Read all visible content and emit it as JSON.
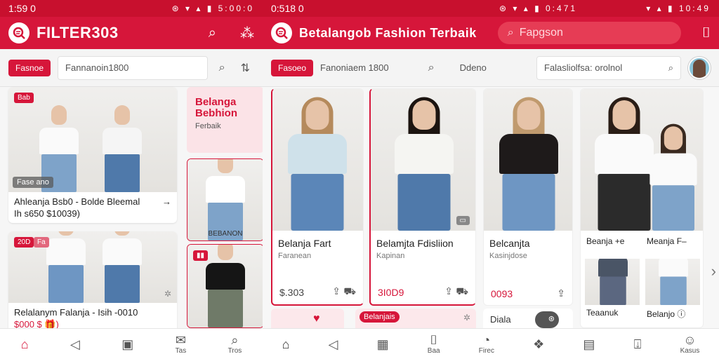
{
  "left": {
    "status": {
      "time": "1:59 0",
      "icons": "⊛ ▾ ▴ ▮ 5:00:0"
    },
    "app": {
      "title": "FILTER303"
    },
    "filter": {
      "chip": "Fasnoe",
      "input": "Fannanoin1800"
    },
    "cards": [
      {
        "badge": "Bab",
        "tag": "Fase ano",
        "caption": "Ahleanja Bsb0 - Bolde Bleemal",
        "sub": "Ih s650 $10039)"
      },
      {
        "badge": "20D",
        "badge2": "Fa",
        "caption": "Relalanym Falanja - Isih -0010",
        "sub": "$000 $ 🎁)"
      }
    ],
    "promo": {
      "heading": "Belanga Bebhion",
      "sub": "Ferbaik"
    },
    "minicards": [
      {
        "label": "BEBANON"
      },
      {
        "label": ""
      }
    ],
    "nav": [
      {
        "icon": "home-icon",
        "glyph": "⌂",
        "label": ""
      },
      {
        "icon": "send-icon",
        "glyph": "◁",
        "label": ""
      },
      {
        "icon": "doc-icon",
        "glyph": "▣",
        "label": ""
      },
      {
        "icon": "mail-icon",
        "glyph": "✉",
        "label": "Tas"
      },
      {
        "icon": "search-icon",
        "glyph": "⌕",
        "label": "Tros"
      }
    ]
  },
  "right": {
    "status": {
      "time": "0:518 0",
      "icons": "⊛ ▾ ▴ ▮ 0:471"
    },
    "status_right": "▾ ▴ ▮ 10:49",
    "app": {
      "title": "Betalangob Fashion Terbaik",
      "search_placeholder": "Fapgson"
    },
    "filter": {
      "chip": "Fasoeo",
      "label": "Fanoniaem 1800",
      "label2": "Ddeno",
      "search": "Falasliolfsa: orolnol"
    },
    "cards": [
      {
        "title": "Belanja Fart",
        "sub": "Faranean",
        "price": "$.303"
      },
      {
        "title": "Belamjta Fdisliion",
        "sub": "Kapinan",
        "price": "3I0D9"
      },
      {
        "title": "Belcanjta",
        "sub": "Kasinjdose",
        "price": "0093"
      }
    ],
    "big": {
      "t1a": "Beanja +e",
      "t1b": "Meanja F–",
      "t2a": "Teaanuk",
      "t2b": "Belanjo"
    },
    "row2_pill": "Belanjais",
    "row2_text": "Diala",
    "nav": [
      {
        "icon": "home-icon",
        "glyph": "⌂",
        "label": ""
      },
      {
        "icon": "send-icon",
        "glyph": "◁",
        "label": ""
      },
      {
        "icon": "grid-icon",
        "glyph": "▦",
        "label": ""
      },
      {
        "icon": "bag-icon",
        "glyph": "⌷",
        "label": "Baa"
      },
      {
        "icon": "clock-icon",
        "glyph": "◔",
        "label": "Firec"
      },
      {
        "icon": "gift-icon",
        "glyph": "❖",
        "label": ""
      },
      {
        "icon": "calendar-icon",
        "glyph": "▤",
        "label": ""
      },
      {
        "icon": "download-icon",
        "glyph": "⍗",
        "label": ""
      },
      {
        "icon": "user-icon",
        "glyph": "☺",
        "label": "Kasus"
      }
    ]
  },
  "colors": {
    "primary": "#d6163a",
    "status": "#c8102e"
  }
}
